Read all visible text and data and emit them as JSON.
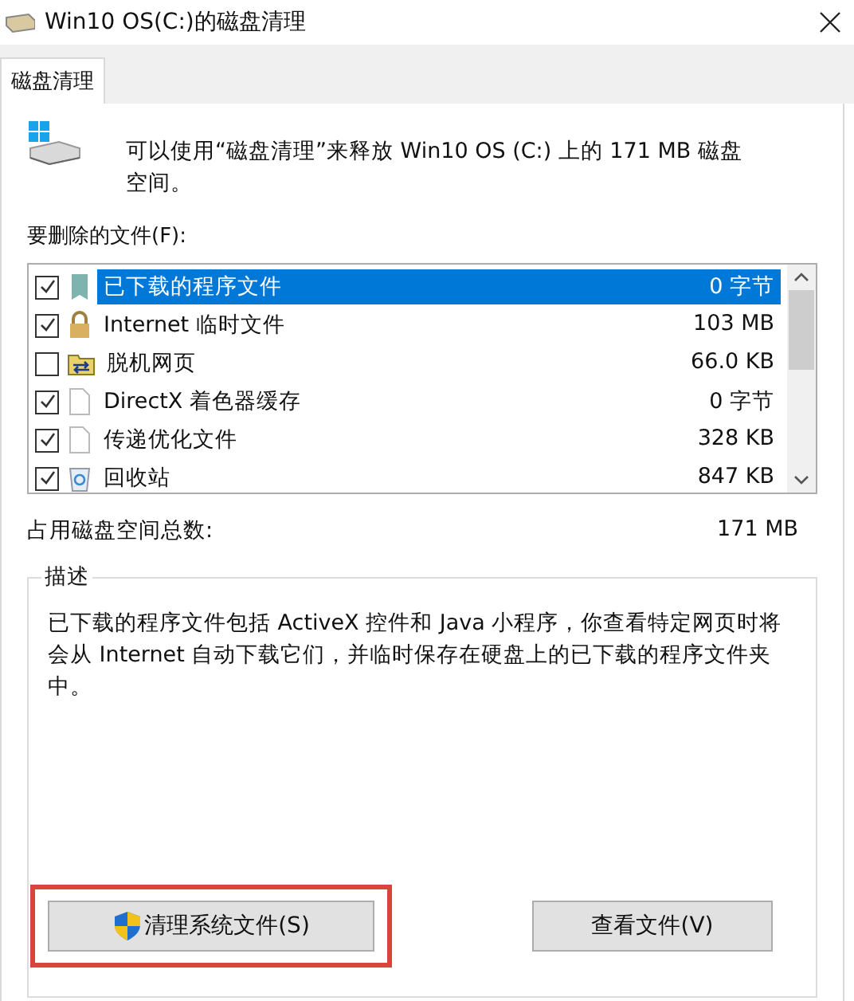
{
  "window": {
    "title": "Win10 OS(C:)的磁盘清理"
  },
  "tabs": [
    {
      "label": "磁盘清理",
      "selected": true
    }
  ],
  "intro": "可以使用“磁盘清理”来释放 Win10 OS (C:) 上的 171 MB 磁盘空间。",
  "files_label": "要删除的文件(F):",
  "files": [
    {
      "kind": "program",
      "name": "已下载的程序文件",
      "size": "0 字节",
      "checked": true,
      "selected": true
    },
    {
      "kind": "lock",
      "name": "Internet 临时文件",
      "size": "103 MB",
      "checked": true,
      "selected": false
    },
    {
      "kind": "offline",
      "name": "脱机网页",
      "size": "66.0 KB",
      "checked": false,
      "selected": false
    },
    {
      "kind": "file",
      "name": "DirectX 着色器缓存",
      "size": "0 字节",
      "checked": true,
      "selected": false
    },
    {
      "kind": "file",
      "name": "传递优化文件",
      "size": "328 KB",
      "checked": true,
      "selected": false
    },
    {
      "kind": "recycle",
      "name": "回收站",
      "size": "847 KB",
      "checked": true,
      "selected": false
    }
  ],
  "total": {
    "label": "占用磁盘空间总数:",
    "value": "171 MB"
  },
  "description": {
    "legend": "描述",
    "text": "已下载的程序文件包括 ActiveX 控件和 Java 小程序，你查看特定网页时将会从 Internet 自动下载它们，并临时保存在硬盘上的已下载的程序文件夹中。"
  },
  "buttons": [
    {
      "kind": "shield",
      "label": "清理系统文件(S)",
      "highlighted": true
    },
    {
      "kind": "plain",
      "label": "查看文件(V)",
      "highlighted": false
    }
  ]
}
